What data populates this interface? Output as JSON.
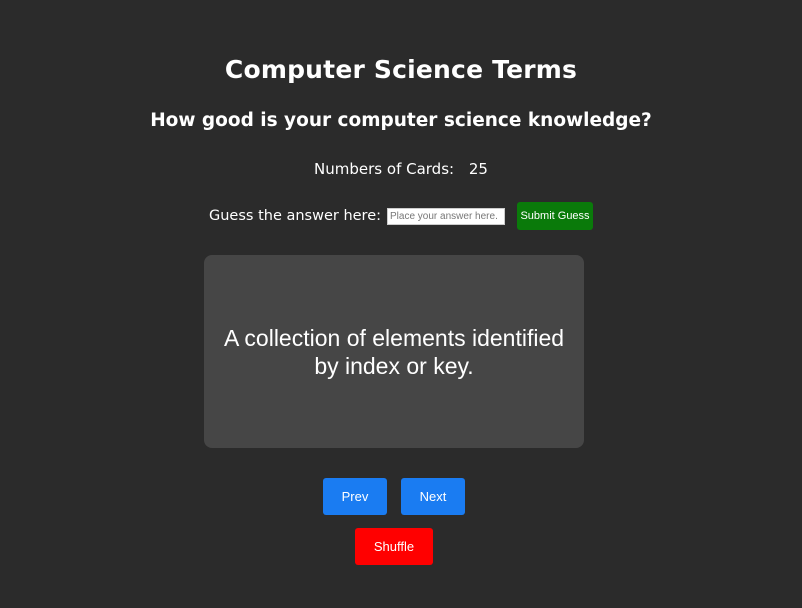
{
  "page": {
    "title": "Computer Science Terms",
    "subtitle": "How good is your computer science knowledge?"
  },
  "stats": {
    "count_label": "Numbers of Cards:",
    "count_value": "25"
  },
  "guess": {
    "label": "Guess the answer here:",
    "placeholder": "Place your answer here.",
    "value": "",
    "submit_label": "Submit Guess"
  },
  "card": {
    "text": "A collection of elements identified by index or key."
  },
  "controls": {
    "prev_label": "Prev",
    "next_label": "Next",
    "shuffle_label": "Shuffle"
  },
  "colors": {
    "background": "#2b2b2b",
    "card": "#464646",
    "submit": "#0a7a0a",
    "nav_buttons": "#1a7cf2",
    "shuffle": "#ff0000"
  }
}
